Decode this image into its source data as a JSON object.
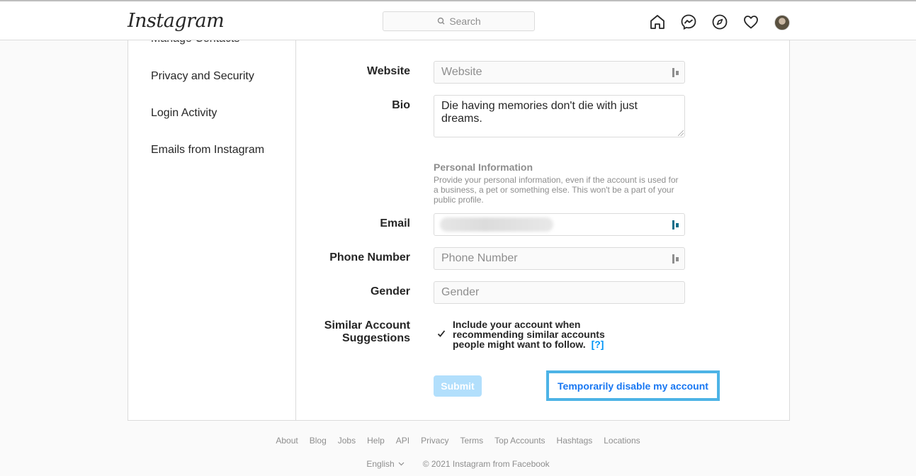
{
  "header": {
    "logo": "Instagram",
    "search_placeholder": "Search"
  },
  "sidebar": {
    "items": [
      {
        "label": "Manage Contacts"
      },
      {
        "label": "Privacy and Security"
      },
      {
        "label": "Login Activity"
      },
      {
        "label": "Emails from Instagram"
      }
    ]
  },
  "form": {
    "website_label": "Website",
    "website_placeholder": "Website",
    "bio_label": "Bio",
    "bio_value": "Die having memories don't die with just dreams.",
    "personal_info_title": "Personal Information",
    "personal_info_desc": "Provide your personal information, even if the account is used for a business, a pet or something else. This won't be a part of your public profile.",
    "email_label": "Email",
    "phone_label": "Phone Number",
    "phone_placeholder": "Phone Number",
    "gender_label": "Gender",
    "gender_placeholder": "Gender",
    "similar_label_line1": "Similar Account",
    "similar_label_line2": "Suggestions",
    "similar_text": "Include your account when recommending similar accounts people might want to follow.",
    "similar_help": "[?]",
    "similar_checked": true,
    "submit_label": "Submit",
    "disable_label": "Temporarily disable my account"
  },
  "footer": {
    "links": [
      "About",
      "Blog",
      "Jobs",
      "Help",
      "API",
      "Privacy",
      "Terms",
      "Top Accounts",
      "Hashtags",
      "Locations"
    ],
    "language": "English",
    "copyright": "© 2021 Instagram from Facebook"
  },
  "colors": {
    "link": "#0095f6",
    "disable_button_text": "#1877f2",
    "highlight_border": "#4db3e6",
    "submit_disabled": "#b2dffc"
  }
}
